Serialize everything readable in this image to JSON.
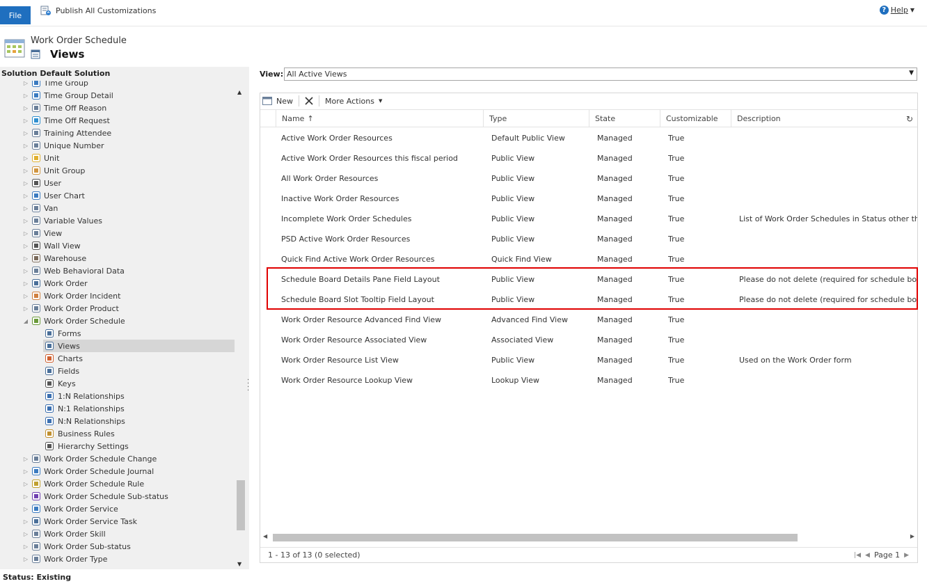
{
  "ribbon": {
    "file_label": "File",
    "publish_label": "Publish All Customizations",
    "help_label": "Help"
  },
  "header": {
    "entity_name": "Work Order Schedule",
    "page_title": "Views"
  },
  "sidebar": {
    "solution_label": "Solution Default Solution",
    "items": [
      {
        "label": "Time Group",
        "icon": "clock-icon",
        "indent": 0
      },
      {
        "label": "Time Group Detail",
        "icon": "clock-icon",
        "indent": 0
      },
      {
        "label": "Time Off Reason",
        "icon": "gear-entity-icon",
        "indent": 0
      },
      {
        "label": "Time Off Request",
        "icon": "beach-umbrella-icon",
        "indent": 0
      },
      {
        "label": "Training Attendee",
        "icon": "gear-entity-icon",
        "indent": 0
      },
      {
        "label": "Unique Number",
        "icon": "gear-entity-icon",
        "indent": 0
      },
      {
        "label": "Unit",
        "icon": "coins-icon",
        "indent": 0
      },
      {
        "label": "Unit Group",
        "icon": "boxes-icon",
        "indent": 0
      },
      {
        "label": "User",
        "icon": "user-icon",
        "indent": 0
      },
      {
        "label": "User Chart",
        "icon": "chart-icon",
        "indent": 0
      },
      {
        "label": "Van",
        "icon": "gear-entity-icon",
        "indent": 0
      },
      {
        "label": "Variable Values",
        "icon": "gear-entity-icon",
        "indent": 0
      },
      {
        "label": "View",
        "icon": "view-icon",
        "indent": 0
      },
      {
        "label": "Wall View",
        "icon": "filter-icon",
        "indent": 0
      },
      {
        "label": "Warehouse",
        "icon": "warehouse-icon",
        "indent": 0
      },
      {
        "label": "Web Behavioral Data",
        "icon": "gear-entity-icon",
        "indent": 0
      },
      {
        "label": "Work Order",
        "icon": "work-order-icon",
        "indent": 0
      },
      {
        "label": "Work Order Incident",
        "icon": "incident-icon",
        "indent": 0
      },
      {
        "label": "Work Order Product",
        "icon": "gear-entity-icon",
        "indent": 0
      },
      {
        "label": "Work Order Schedule",
        "icon": "calendar-icon",
        "indent": 0,
        "expanded": true
      },
      {
        "label": "Forms",
        "icon": "form-icon",
        "indent": 1
      },
      {
        "label": "Views",
        "icon": "views-icon",
        "indent": 1,
        "selected": true
      },
      {
        "label": "Charts",
        "icon": "bar-chart-icon",
        "indent": 1
      },
      {
        "label": "Fields",
        "icon": "fields-icon",
        "indent": 1
      },
      {
        "label": "Keys",
        "icon": "key-icon",
        "indent": 1
      },
      {
        "label": "1:N Relationships",
        "icon": "relationship-icon",
        "indent": 1
      },
      {
        "label": "N:1 Relationships",
        "icon": "relationship-icon",
        "indent": 1
      },
      {
        "label": "N:N Relationships",
        "icon": "relationship-icon",
        "indent": 1
      },
      {
        "label": "Business Rules",
        "icon": "business-rules-icon",
        "indent": 1
      },
      {
        "label": "Hierarchy Settings",
        "icon": "hierarchy-icon",
        "indent": 1
      },
      {
        "label": "Work Order Schedule Change",
        "icon": "gear-entity-icon",
        "indent": 0
      },
      {
        "label": "Work Order Schedule Journal",
        "icon": "journal-icon",
        "indent": 0
      },
      {
        "label": "Work Order Schedule Rule",
        "icon": "rule-icon",
        "indent": 0
      },
      {
        "label": "Work Order Schedule Sub-status",
        "icon": "status-icon",
        "indent": 0
      },
      {
        "label": "Work Order Service",
        "icon": "truck-icon",
        "indent": 0
      },
      {
        "label": "Work Order Service Task",
        "icon": "task-list-icon",
        "indent": 0
      },
      {
        "label": "Work Order Skill",
        "icon": "gear-entity-icon",
        "indent": 0
      },
      {
        "label": "Work Order Sub-status",
        "icon": "substatus-icon",
        "indent": 0
      },
      {
        "label": "Work Order Type",
        "icon": "type-icon",
        "indent": 0
      }
    ]
  },
  "status": "Status: Existing",
  "view_selector": {
    "label": "View:",
    "value": "All Active Views"
  },
  "toolbar": {
    "new_label": "New",
    "more_actions_label": "More Actions"
  },
  "grid": {
    "columns": [
      "Name",
      "Type",
      "State",
      "Customizable",
      "Description"
    ],
    "rows": [
      {
        "name": "Active Work Order Resources",
        "type": "Default Public View",
        "state": "Managed",
        "customizable": "True",
        "description": ""
      },
      {
        "name": "Active Work Order Resources this fiscal period",
        "type": "Public View",
        "state": "Managed",
        "customizable": "True",
        "description": ""
      },
      {
        "name": "All Work Order Resources",
        "type": "Public View",
        "state": "Managed",
        "customizable": "True",
        "description": ""
      },
      {
        "name": "Inactive Work Order Resources",
        "type": "Public View",
        "state": "Managed",
        "customizable": "True",
        "description": ""
      },
      {
        "name": "Incomplete Work Order Schedules",
        "type": "Public View",
        "state": "Managed",
        "customizable": "True",
        "description": "List of Work Order Schedules in Status other than Co"
      },
      {
        "name": "PSD Active Work Order Resources",
        "type": "Public View",
        "state": "Managed",
        "customizable": "True",
        "description": ""
      },
      {
        "name": "Quick Find Active Work Order Resources",
        "type": "Quick Find View",
        "state": "Managed",
        "customizable": "True",
        "description": ""
      },
      {
        "name": "Schedule Board Details Pane Field Layout",
        "type": "Public View",
        "state": "Managed",
        "customizable": "True",
        "description": "Please do not delete (required for schedule board)"
      },
      {
        "name": "Schedule Board Slot Tooltip Field Layout",
        "type": "Public View",
        "state": "Managed",
        "customizable": "True",
        "description": "Please do not delete (required for schedule board)"
      },
      {
        "name": "Work Order Resource Advanced Find View",
        "type": "Advanced Find View",
        "state": "Managed",
        "customizable": "True",
        "description": ""
      },
      {
        "name": "Work Order Resource Associated View",
        "type": "Associated View",
        "state": "Managed",
        "customizable": "True",
        "description": ""
      },
      {
        "name": "Work Order Resource List View",
        "type": "Public View",
        "state": "Managed",
        "customizable": "True",
        "description": "Used on the Work Order form"
      },
      {
        "name": "Work Order Resource Lookup View",
        "type": "Lookup View",
        "state": "Managed",
        "customizable": "True",
        "description": ""
      }
    ],
    "footer": {
      "record_count": "1 - 13 of 13 (0 selected)",
      "page_label": "Page 1"
    }
  },
  "colors": {
    "accent": "#1f6fbf",
    "highlight": "#e00000",
    "sidebar_bg": "#f0f0f0",
    "selected_bg": "#d6d6d6"
  }
}
